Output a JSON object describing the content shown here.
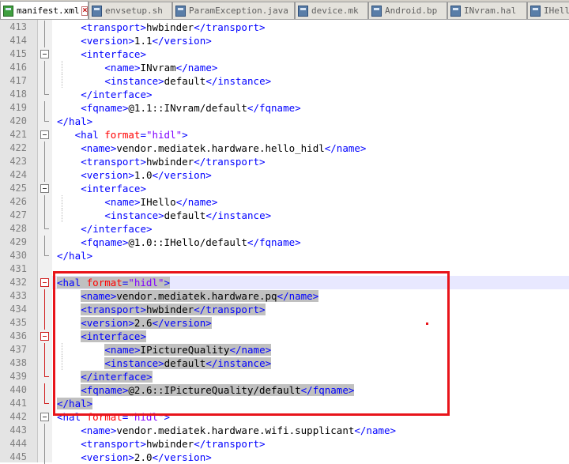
{
  "tabs": [
    {
      "label": "manifest.xml",
      "active": true
    },
    {
      "label": "envsetup.sh",
      "active": false
    },
    {
      "label": "ParamException.java",
      "active": false
    },
    {
      "label": "device.mk",
      "active": false
    },
    {
      "label": "Android.bp",
      "active": false
    },
    {
      "label": "INvram.hal",
      "active": false
    },
    {
      "label": "IHell",
      "active": false
    }
  ],
  "colors": {
    "tag": "#0000ff",
    "attribute": "#ff0000",
    "attribute_value": "#8000ff",
    "text": "#000000",
    "highlight_box": "#e8141a",
    "selection": "#c0c0c0"
  },
  "editor": {
    "current_line": 432,
    "lines": [
      {
        "n": "413",
        "parts": [
          {
            "t": "tag",
            "s": "<transport>"
          },
          {
            "t": "txt",
            "s": "hwbinder"
          },
          {
            "t": "tag",
            "s": "</transport>"
          }
        ]
      },
      {
        "n": "414",
        "parts": [
          {
            "t": "tag",
            "s": "<version>"
          },
          {
            "t": "txt",
            "s": "1.1"
          },
          {
            "t": "tag",
            "s": "</version>"
          }
        ]
      },
      {
        "n": "415",
        "parts": [
          {
            "t": "tag",
            "s": "<interface>"
          }
        ]
      },
      {
        "n": "416",
        "parts": [
          {
            "t": "tag",
            "s": "<name>"
          },
          {
            "t": "txt",
            "s": "INvram"
          },
          {
            "t": "tag",
            "s": "</name>"
          }
        ]
      },
      {
        "n": "417",
        "parts": [
          {
            "t": "tag",
            "s": "<instance>"
          },
          {
            "t": "txt",
            "s": "default"
          },
          {
            "t": "tag",
            "s": "</instance>"
          }
        ]
      },
      {
        "n": "418",
        "parts": [
          {
            "t": "tag",
            "s": "</interface>"
          }
        ]
      },
      {
        "n": "419",
        "parts": [
          {
            "t": "tag",
            "s": "<fqname>"
          },
          {
            "t": "txt",
            "s": "@1.1::INvram/default"
          },
          {
            "t": "tag",
            "s": "</fqname>"
          }
        ]
      },
      {
        "n": "420",
        "parts": [
          {
            "t": "tag",
            "s": "</hal>"
          }
        ]
      },
      {
        "n": "421",
        "parts": [
          {
            "t": "tag",
            "s": "<hal "
          },
          {
            "t": "attr",
            "s": "format"
          },
          {
            "t": "tag",
            "s": "="
          },
          {
            "t": "val",
            "s": "\"hidl\""
          },
          {
            "t": "tag",
            "s": ">"
          }
        ]
      },
      {
        "n": "422",
        "parts": [
          {
            "t": "tag",
            "s": "<name>"
          },
          {
            "t": "txt",
            "s": "vendor.mediatek.hardware.hello_hidl"
          },
          {
            "t": "tag",
            "s": "</name>"
          }
        ]
      },
      {
        "n": "423",
        "parts": [
          {
            "t": "tag",
            "s": "<transport>"
          },
          {
            "t": "txt",
            "s": "hwbinder"
          },
          {
            "t": "tag",
            "s": "</transport>"
          }
        ]
      },
      {
        "n": "424",
        "parts": [
          {
            "t": "tag",
            "s": "<version>"
          },
          {
            "t": "txt",
            "s": "1.0"
          },
          {
            "t": "tag",
            "s": "</version>"
          }
        ]
      },
      {
        "n": "425",
        "parts": [
          {
            "t": "tag",
            "s": "<interface>"
          }
        ]
      },
      {
        "n": "426",
        "parts": [
          {
            "t": "tag",
            "s": "<name>"
          },
          {
            "t": "txt",
            "s": "IHello"
          },
          {
            "t": "tag",
            "s": "</name>"
          }
        ]
      },
      {
        "n": "427",
        "parts": [
          {
            "t": "tag",
            "s": "<instance>"
          },
          {
            "t": "txt",
            "s": "default"
          },
          {
            "t": "tag",
            "s": "</instance>"
          }
        ]
      },
      {
        "n": "428",
        "parts": [
          {
            "t": "tag",
            "s": "</interface>"
          }
        ]
      },
      {
        "n": "429",
        "parts": [
          {
            "t": "tag",
            "s": "<fqname>"
          },
          {
            "t": "txt",
            "s": "@1.0::IHello/default"
          },
          {
            "t": "tag",
            "s": "</fqname>"
          }
        ]
      },
      {
        "n": "430",
        "parts": [
          {
            "t": "tag",
            "s": "</hal>"
          }
        ]
      },
      {
        "n": "431",
        "parts": []
      },
      {
        "n": "432",
        "parts": [
          {
            "t": "tag",
            "s": "<hal "
          },
          {
            "t": "attr",
            "s": "format"
          },
          {
            "t": "tag",
            "s": "="
          },
          {
            "t": "val",
            "s": "\"hidl\""
          },
          {
            "t": "tag",
            "s": ">"
          }
        ]
      },
      {
        "n": "433",
        "parts": [
          {
            "t": "tag",
            "s": "<name>"
          },
          {
            "t": "txt",
            "s": "vendor.mediatek.hardware.pq"
          },
          {
            "t": "tag",
            "s": "</name>"
          }
        ]
      },
      {
        "n": "434",
        "parts": [
          {
            "t": "tag",
            "s": "<transport>"
          },
          {
            "t": "txt",
            "s": "hwbinder"
          },
          {
            "t": "tag",
            "s": "</transport>"
          }
        ]
      },
      {
        "n": "435",
        "parts": [
          {
            "t": "tag",
            "s": "<version>"
          },
          {
            "t": "txt",
            "s": "2.6"
          },
          {
            "t": "tag",
            "s": "</version>"
          }
        ]
      },
      {
        "n": "436",
        "parts": [
          {
            "t": "tag",
            "s": "<interface>"
          }
        ]
      },
      {
        "n": "437",
        "parts": [
          {
            "t": "tag",
            "s": "<name>"
          },
          {
            "t": "txt",
            "s": "IPictureQuality"
          },
          {
            "t": "tag",
            "s": "</name>"
          }
        ]
      },
      {
        "n": "438",
        "parts": [
          {
            "t": "tag",
            "s": "<instance>"
          },
          {
            "t": "txt",
            "s": "default"
          },
          {
            "t": "tag",
            "s": "</instance>"
          }
        ]
      },
      {
        "n": "439",
        "parts": [
          {
            "t": "tag",
            "s": "</interface>"
          }
        ]
      },
      {
        "n": "440",
        "parts": [
          {
            "t": "tag",
            "s": "<fqname>"
          },
          {
            "t": "txt",
            "s": "@2.6::IPictureQuality/default"
          },
          {
            "t": "tag",
            "s": "</fqname>"
          }
        ]
      },
      {
        "n": "441",
        "parts": [
          {
            "t": "tag",
            "s": "</hal>"
          }
        ]
      },
      {
        "n": "442",
        "parts": [
          {
            "t": "tag",
            "s": "<hal "
          },
          {
            "t": "attr",
            "s": "format"
          },
          {
            "t": "tag",
            "s": "="
          },
          {
            "t": "val",
            "s": "\"hidl\""
          },
          {
            "t": "tag",
            "s": ">"
          }
        ]
      },
      {
        "n": "443",
        "parts": [
          {
            "t": "tag",
            "s": "<name>"
          },
          {
            "t": "txt",
            "s": "vendor.mediatek.hardware.wifi.supplicant"
          },
          {
            "t": "tag",
            "s": "</name>"
          }
        ]
      },
      {
        "n": "444",
        "parts": [
          {
            "t": "tag",
            "s": "<transport>"
          },
          {
            "t": "txt",
            "s": "hwbinder"
          },
          {
            "t": "tag",
            "s": "</transport>"
          }
        ]
      },
      {
        "n": "445",
        "parts": [
          {
            "t": "tag",
            "s": "<version>"
          },
          {
            "t": "txt",
            "s": "2.0"
          },
          {
            "t": "tag",
            "s": "</version>"
          }
        ]
      }
    ]
  }
}
